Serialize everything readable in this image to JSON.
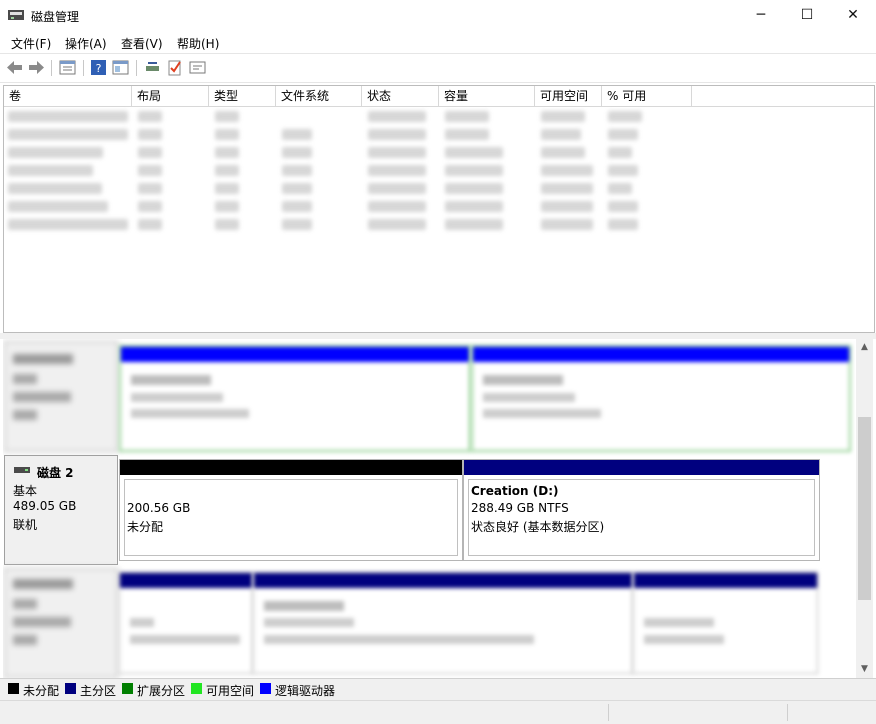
{
  "window": {
    "title": "磁盘管理",
    "minimize_glyph": "─",
    "maximize_glyph": "☐",
    "close_glyph": "✕"
  },
  "menu": [
    "文件(F)",
    "操作(A)",
    "查看(V)",
    "帮助(H)"
  ],
  "toolbar": {
    "icons": [
      "back-icon",
      "forward-icon",
      "properties-list-icon",
      "help-icon",
      "console-icon",
      "connect-icon",
      "check-icon",
      "settings-icon"
    ]
  },
  "volume_list": {
    "columns": [
      "卷",
      "布局",
      "类型",
      "文件系统",
      "状态",
      "容量",
      "可用空间",
      "% 可用"
    ]
  },
  "disks": {
    "disk2": {
      "name": "磁盘 2",
      "type": "基本",
      "size": "489.05 GB",
      "status": "联机",
      "unallocated": {
        "size": "200.56 GB",
        "label": "未分配"
      },
      "partition": {
        "name": "Creation  (D:)",
        "fs": "288.49 GB NTFS",
        "status": "状态良好 (基本数据分区)"
      }
    }
  },
  "legend": [
    {
      "label": "未分配",
      "color": "#000000"
    },
    {
      "label": "主分区",
      "color": "#00007f"
    },
    {
      "label": "扩展分区",
      "color": "#007f00"
    },
    {
      "label": "可用空间",
      "color": "#22e622"
    },
    {
      "label": "逻辑驱动器",
      "color": "#0000ff"
    }
  ],
  "colors": {
    "primary_partition": "#00007f",
    "logical_drive": "#0000ff",
    "unallocated": "#000000",
    "extended": "#7fbf7f"
  }
}
